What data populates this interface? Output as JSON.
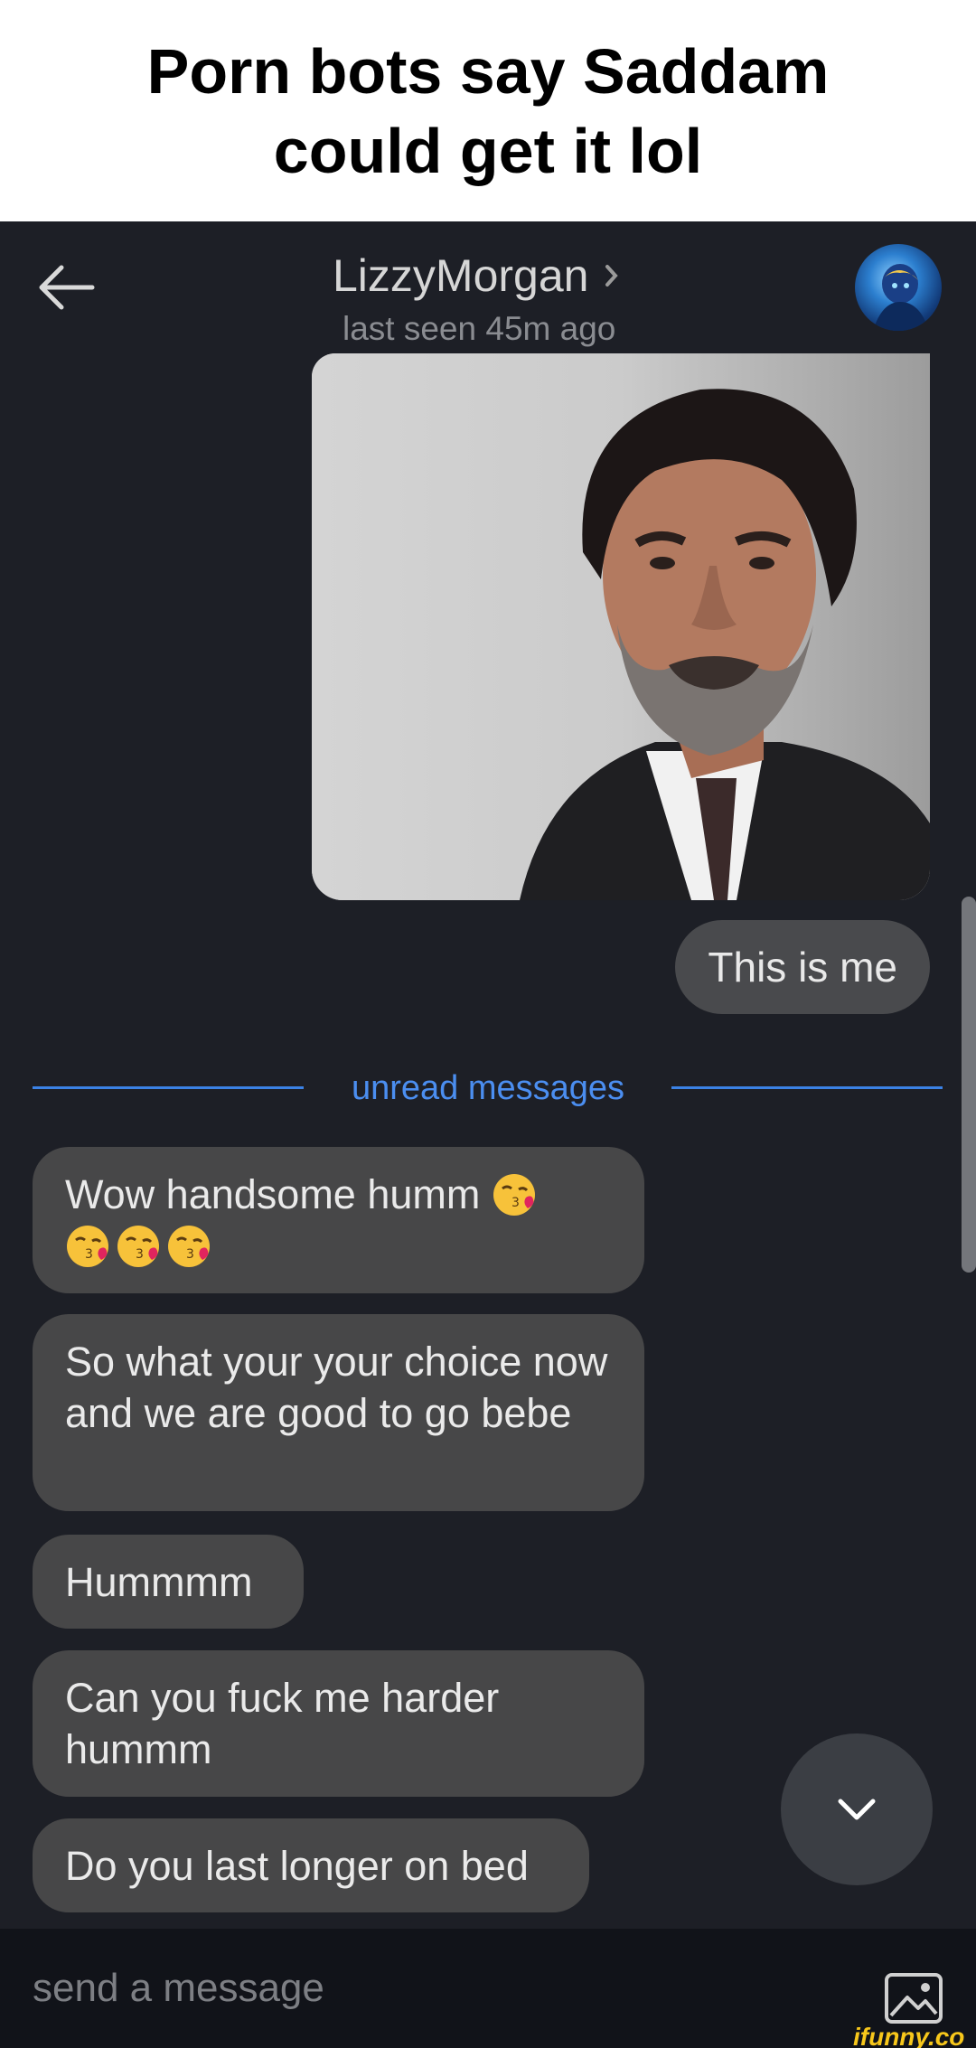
{
  "caption": "Porn bots say Saddam could get it lol",
  "header": {
    "contact_name": "LizzyMorgan",
    "last_seen": "last seen 45m ago"
  },
  "messages": {
    "outgoing": [
      "This is me"
    ],
    "unread_label": "unread messages",
    "incoming": [
      {
        "text": "Wow handsome humm",
        "emoji_count": 4,
        "emoji": "kissing-face-with-heart"
      },
      {
        "text": "So what  your your choice now and we are good to go bebe"
      },
      {
        "text": "Hummmm"
      },
      {
        "text": "Can you fuck me harder hummm"
      },
      {
        "text": "Do you last longer on bed"
      }
    ]
  },
  "compose": {
    "placeholder": "send a message"
  },
  "watermark": "ifunny.co",
  "colors": {
    "background": "#1d1f26",
    "bubble": "#474748",
    "accent": "#4b8ef0",
    "compose": "#111319"
  }
}
